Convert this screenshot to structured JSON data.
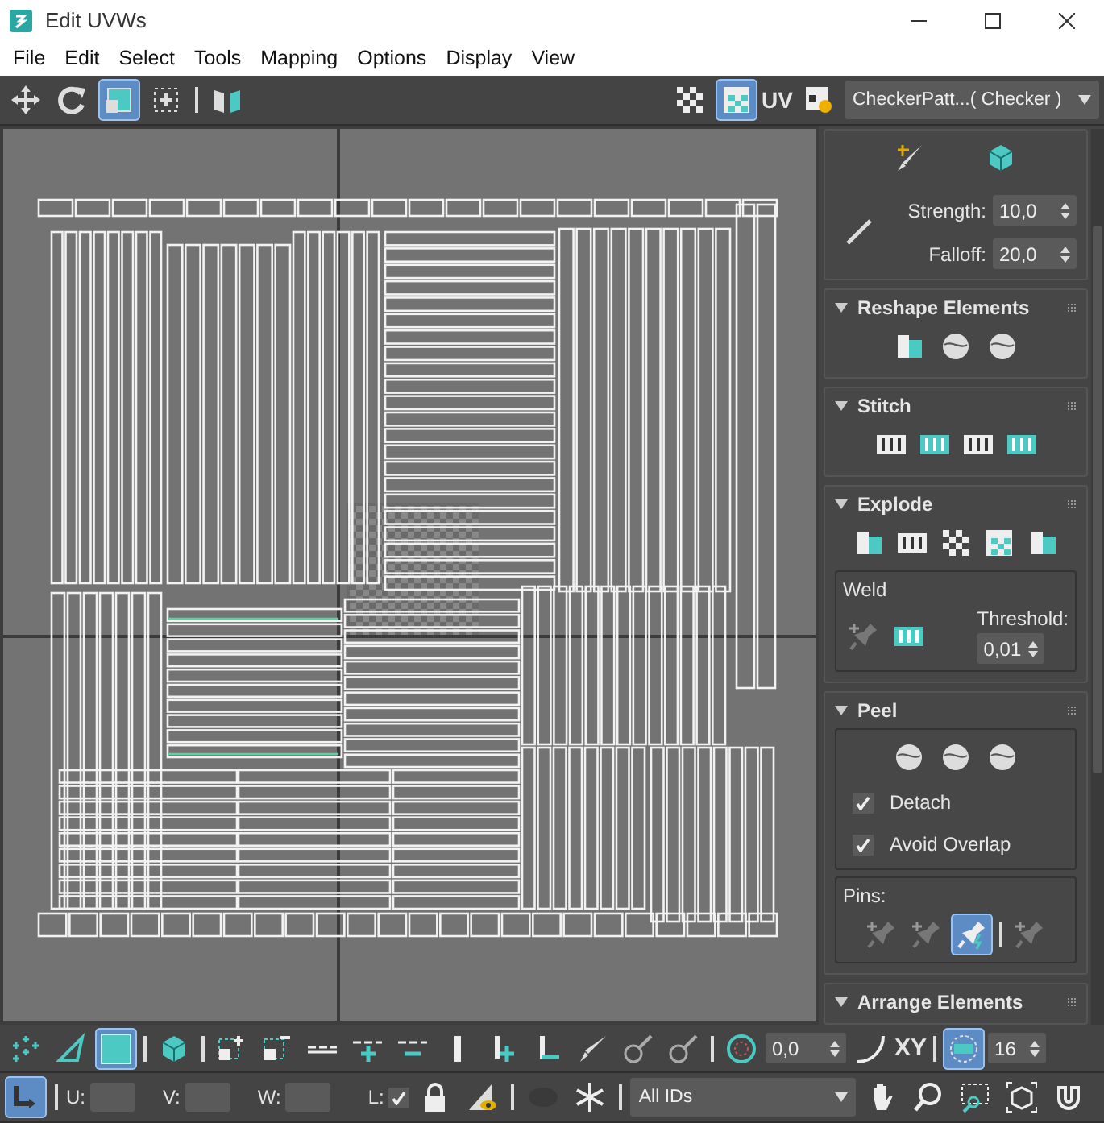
{
  "window": {
    "title": "Edit UVWs"
  },
  "menu": [
    "File",
    "Edit",
    "Select",
    "Tools",
    "Mapping",
    "Options",
    "Display",
    "View"
  ],
  "toolbar": {
    "tools": [
      {
        "selected": false
      },
      {
        "selected": false
      },
      {
        "selected": true
      },
      {
        "selected": false
      },
      {
        "selected": false
      }
    ],
    "view_tools": [
      {
        "selected": false
      },
      {
        "selected": true
      },
      {
        "selected": false
      }
    ],
    "uv_label": "UV",
    "map_dropdown": "CheckerPatt...( Checker )"
  },
  "brush": {
    "strength_label": "Strength:",
    "strength": "10,0",
    "falloff_label": "Falloff:",
    "falloff": "20,0"
  },
  "rollouts": [
    {
      "kind": "reshape",
      "title": "Reshape Elements",
      "expanded": true
    },
    {
      "kind": "stitch",
      "title": "Stitch",
      "expanded": true
    },
    {
      "kind": "explode",
      "title": "Explode",
      "expanded": true
    },
    {
      "kind": "peel",
      "title": "Peel",
      "expanded": true
    },
    {
      "kind": "arrange",
      "title": "Arrange Elements",
      "expanded": true
    }
  ],
  "explode": {
    "weld_label": "Weld",
    "threshold_label": "Threshold:",
    "threshold": "0,01"
  },
  "peel": {
    "options": [
      {
        "label": "Detach",
        "checked": true
      },
      {
        "label": "Avoid Overlap",
        "checked": true
      }
    ],
    "pins_label": "Pins:",
    "pins": [
      {
        "selected": false
      },
      {
        "selected": false
      },
      {
        "selected": true
      },
      {
        "selected": false
      }
    ]
  },
  "bottom": {
    "select_modes": [
      {
        "selected": false
      },
      {
        "selected": false
      },
      {
        "selected": true
      },
      {
        "selected": false
      }
    ],
    "soft_value": "0,0",
    "axis": "XY",
    "grid_toggle_selected": true,
    "count": "16"
  },
  "status": {
    "transform_selected": true,
    "u_label": "U:",
    "v_label": "V:",
    "w_label": "W:",
    "l_label": "L:",
    "lock_checked": true,
    "ids": "All IDs"
  }
}
